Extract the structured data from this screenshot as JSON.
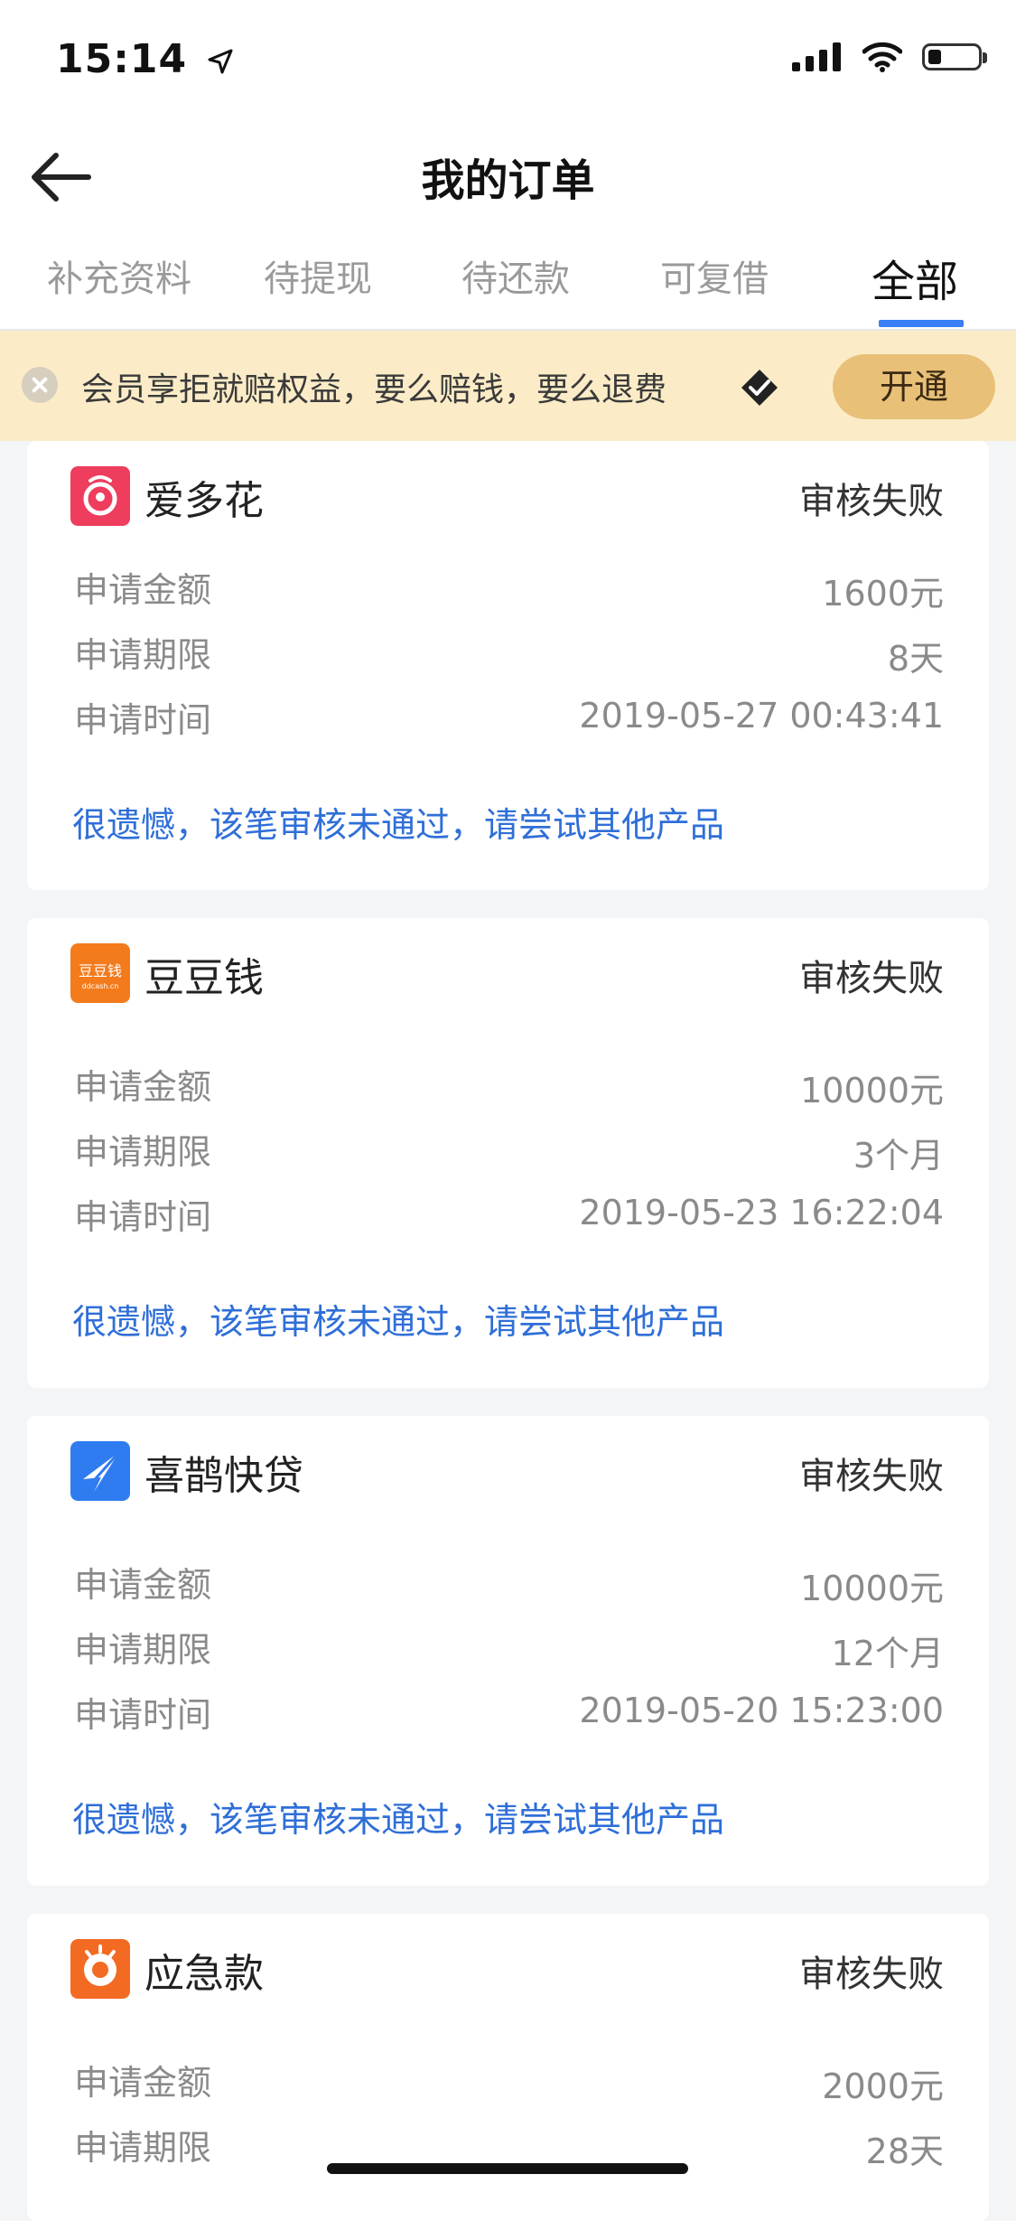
{
  "status": {
    "time": "15:14"
  },
  "nav": {
    "title": "我的订单"
  },
  "tabs": [
    "补充资料",
    "待提现",
    "待还款",
    "可复借",
    "全部"
  ],
  "promo": {
    "text": "会员享拒就赔权益，要么赔钱，要么退费",
    "button": "开通"
  },
  "labels": {
    "amount": "申请金额",
    "term": "申请期限",
    "time": "申请时间"
  },
  "orders": [
    {
      "name": "爱多花",
      "status": "审核失败",
      "amount": "1600元",
      "term": "8天",
      "time": "2019-05-27 00:43:41",
      "message": "很遗憾，该笔审核未通过，请尝试其他产品"
    },
    {
      "name": "豆豆钱",
      "status": "审核失败",
      "amount": "10000元",
      "term": "3个月",
      "time": "2019-05-23 16:22:04",
      "message": "很遗憾，该笔审核未通过，请尝试其他产品",
      "logo_text": "豆豆钱",
      "logo_sub": "ddcash.cn"
    },
    {
      "name": "喜鹊快贷",
      "status": "审核失败",
      "amount": "10000元",
      "term": "12个月",
      "time": "2019-05-20 15:23:00",
      "message": "很遗憾，该笔审核未通过，请尝试其他产品"
    },
    {
      "name": "应急款",
      "status": "审核失败",
      "amount": "2000元",
      "term": "28天"
    }
  ],
  "colors": {
    "accent": "#3a7ff6",
    "link": "#2f6fd8",
    "promo_bg": "#fbecc7",
    "promo_button": "#e8c078"
  }
}
